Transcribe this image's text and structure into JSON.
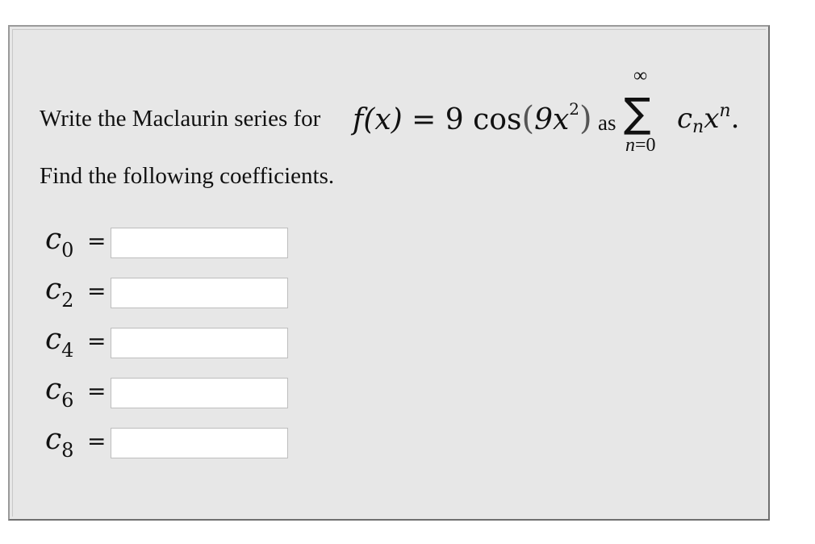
{
  "question": {
    "prefix_text": "Write the Maclaurin series for",
    "function_lhs": "f(x)",
    "equals": " = ",
    "coefficient": "9",
    "func_name": " cos",
    "open_paren": "(",
    "inner_coeff": "9x",
    "inner_exp": "2",
    "close_paren": ")",
    "as_word": "as",
    "sum_upper": "∞",
    "sum_symbol": "∑",
    "sum_lower_var": "n",
    "sum_lower_rest": "=0",
    "term_base": "c",
    "term_sub": "n",
    "term_var": "x",
    "term_exp": "n",
    "term_period": "."
  },
  "instructions": "Find the following coefficients.",
  "coefficients": [
    {
      "symbol": "c",
      "index": "0",
      "equals": "=",
      "value": ""
    },
    {
      "symbol": "c",
      "index": "2",
      "equals": "=",
      "value": ""
    },
    {
      "symbol": "c",
      "index": "4",
      "equals": "=",
      "value": ""
    },
    {
      "symbol": "c",
      "index": "6",
      "equals": "=",
      "value": ""
    },
    {
      "symbol": "c",
      "index": "8",
      "equals": "=",
      "value": ""
    }
  ],
  "colors": {
    "panel_bg": "#e7e7e7",
    "input_bg": "#ffffff",
    "input_border": "#bdbdbd"
  }
}
